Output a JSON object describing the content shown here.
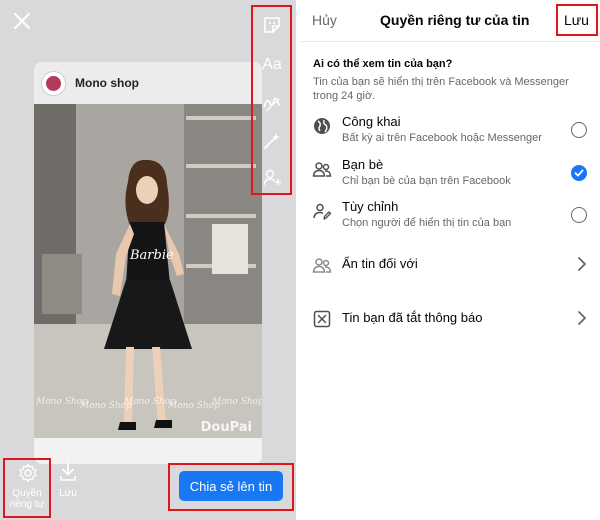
{
  "story": {
    "shop_name": "Mono shop",
    "watermark": "DouPai",
    "photo_text": [
      "Barbie",
      "Mono Shop",
      "Mono Shop",
      "Mono Shop",
      "Mono Shop",
      "Mono Shop"
    ],
    "tools": {
      "text_label": "Aa"
    },
    "bottom": {
      "privacy_label_line1": "Quyền",
      "privacy_label_line2": "riêng tư",
      "save_label": "Lưu",
      "share_label": "Chia sẻ lên tin"
    }
  },
  "privacy": {
    "cancel_label": "Hủy",
    "title": "Quyền riêng tư của tin",
    "save_label": "Lưu",
    "question": "Ai có thể xem tin của bạn?",
    "question_desc": "Tin của bạn sẽ hiển thị trên Facebook và Messenger trong 24 giờ.",
    "options": [
      {
        "title": "Công khai",
        "subtitle": "Bất kỳ ai trên Facebook hoặc Messenger",
        "selected": false
      },
      {
        "title": "Bạn bè",
        "subtitle": "Chỉ bạn bè của bạn trên Facebook",
        "selected": true
      },
      {
        "title": "Tùy chỉnh",
        "subtitle": "Chọn người để hiển thị tin của bạn",
        "selected": false
      }
    ],
    "rows": [
      {
        "title": "Ẩn tin đối với"
      },
      {
        "title": "Tin bạn đã tắt thông báo"
      }
    ]
  },
  "colors": {
    "accent": "#1877f2",
    "highlight_frame": "#e0161d",
    "editor_bg": "#d9d9db"
  }
}
